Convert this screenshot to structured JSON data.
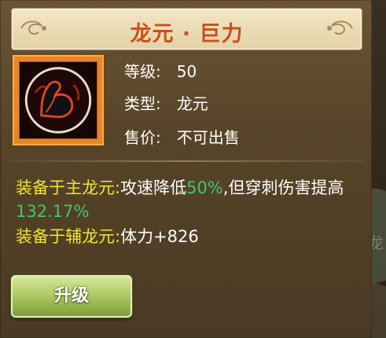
{
  "item": {
    "title": "龙元 · 巨力",
    "icon": "flexed-arm-icon",
    "level_label": "等级:",
    "level_value": "50",
    "type_label": "类型:",
    "type_value": "龙元",
    "price_label": "售价:",
    "price_value": "不可出售"
  },
  "effects": {
    "main_label": "装备于主龙元:",
    "main_text_1": "攻速降低",
    "main_value_1": "50%",
    "main_text_2": ",但穿刺伤害提高",
    "main_value_2": "132.17%",
    "aux_label": "装备于辅龙元:",
    "aux_text": "体力+826"
  },
  "actions": {
    "upgrade_label": "升级"
  },
  "background": {
    "fragment_text": "锁定龙"
  },
  "colors": {
    "title": "#c8501e",
    "label_yellow": "#f2e337",
    "value_green": "#3ec86a",
    "icon_frame": "#e8862a"
  }
}
